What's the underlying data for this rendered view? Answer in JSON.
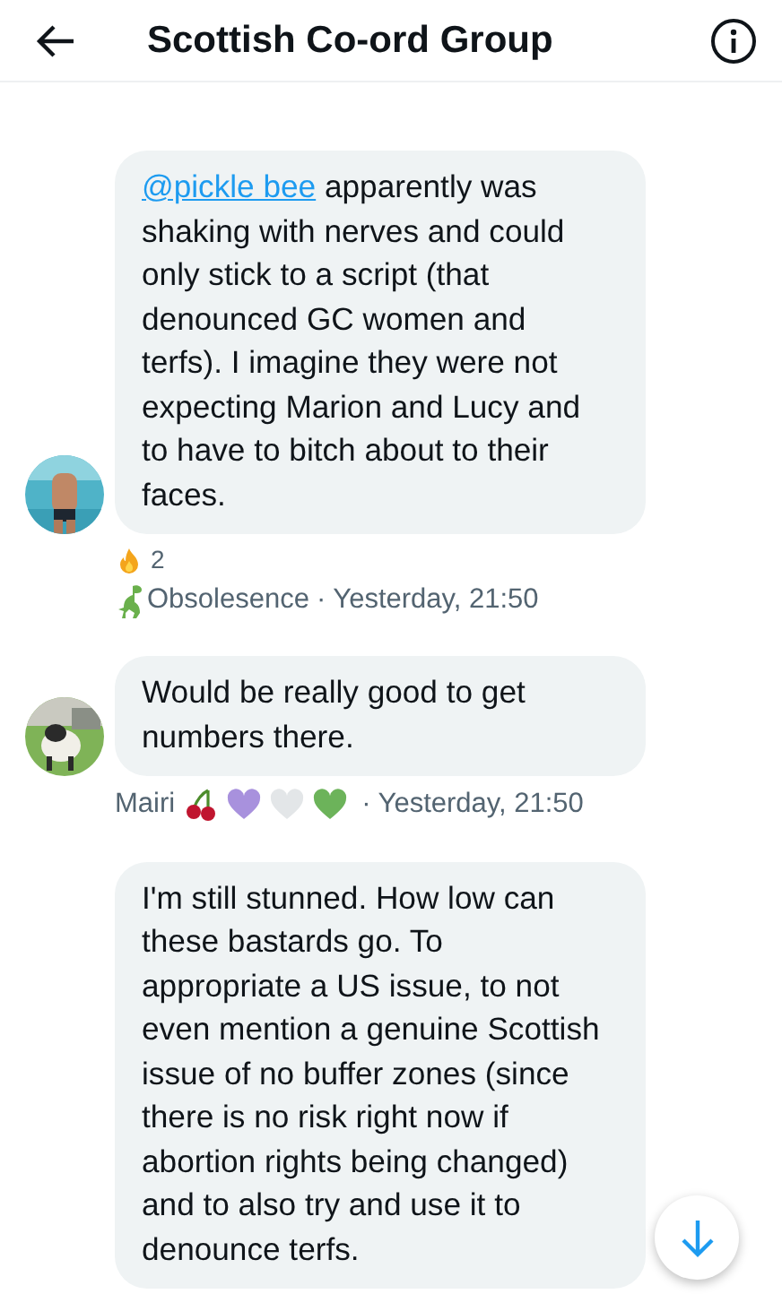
{
  "header": {
    "title": "Scottish Co-ord Group"
  },
  "messages": [
    {
      "avatar": {
        "kind": "picture"
      },
      "parts": [
        {
          "kind": "mention",
          "text": "@pickle bee"
        },
        {
          "kind": "text",
          "text": " apparently was shaking with nerves and could only stick to a script (that denounced GC women and terfs). I imagine they were not expecting Marion and Lucy and to have to bitch about to their faces."
        }
      ],
      "reactions": [
        {
          "kind": "fire",
          "count": "2"
        }
      ],
      "sender": {
        "name": "Obsolesence",
        "badges": [
          {
            "kind": "dinosaur"
          }
        ],
        "badges_before": true
      },
      "time": "· Yesterday, 21:50"
    },
    {
      "avatar": {
        "kind": "picture"
      },
      "parts": [
        {
          "kind": "text",
          "text": "Would be really good to get numbers there."
        }
      ],
      "sender": {
        "name": "Mairi",
        "badges": [
          {
            "kind": "cherry"
          },
          {
            "kind": "heart",
            "color": "#a891dd"
          },
          {
            "kind": "heart",
            "color": "#e3e6e8"
          },
          {
            "kind": "heart",
            "color": "#6cb35a"
          }
        ],
        "badges_before": false
      },
      "time": "· Yesterday, 21:50"
    },
    {
      "parts": [
        {
          "kind": "text",
          "text": "I'm still stunned. How low can these bastards go. To appropriate a US issue, to not even mention a genuine Scottish issue of no buffer zones (since there is no risk right now if abortion rights being changed) and to also try and use it to denounce terfs."
        }
      ]
    }
  ]
}
